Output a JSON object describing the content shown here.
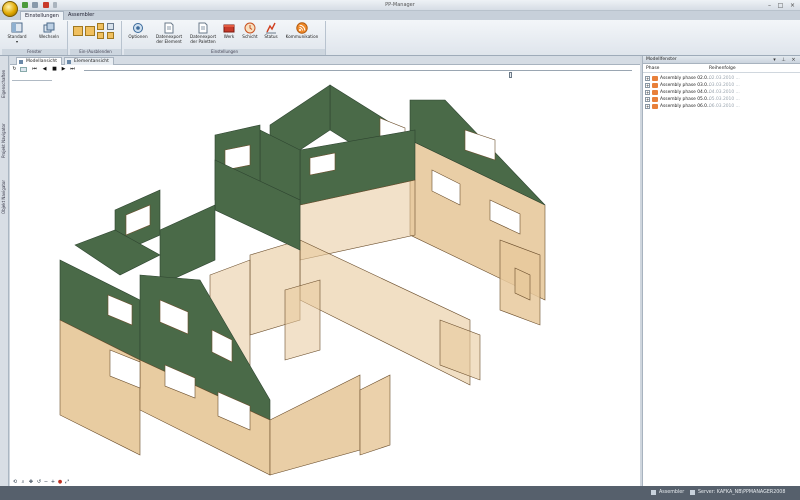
{
  "window": {
    "title": "PP-Manager"
  },
  "ribbon": {
    "tabs": [
      {
        "label": "Einstellungen",
        "active": true
      },
      {
        "label": "Assembler",
        "active": false
      }
    ],
    "groups": [
      {
        "label": "Fenster"
      },
      {
        "label": "Ein-/Ausblenden"
      },
      {
        "label": "Einstellungen"
      }
    ],
    "buttons": {
      "standard": "Standard",
      "wechseln": "Wechseln",
      "optionen": "Optionen",
      "export_element_1": "Datenexport",
      "export_element_2": "der Element",
      "export_paletten_1": "Datenexport",
      "export_paletten_2": "der Paletten",
      "werk": "Werk",
      "schicht": "Schicht",
      "status": "Status",
      "kommunikation": "Kommunikation"
    }
  },
  "left_sidebar": {
    "tabs": [
      "Eigenschaften",
      "Projekt Navigator",
      "Objekt Navigator"
    ]
  },
  "document": {
    "tabs": [
      {
        "label": "Modellansicht",
        "active": true
      },
      {
        "label": "Elementansicht",
        "active": false
      }
    ],
    "timeline_position": 0.78
  },
  "model_panel": {
    "title": "Modellfenster",
    "columns": {
      "phase": "Phase",
      "order": "Reihenfolge"
    },
    "rows": [
      {
        "phase": "Assembly phase 02.0...",
        "date": "02.03.2010 ..."
      },
      {
        "phase": "Assembly phase 03.0...",
        "date": "03.03.2010 ..."
      },
      {
        "phase": "Assembly phase 04.0...",
        "date": "04.03.2010 ..."
      },
      {
        "phase": "Assembly phase 05.0...",
        "date": "05.03.2010 ..."
      },
      {
        "phase": "Assembly phase 06.0...",
        "date": "06.03.2010 ..."
      }
    ]
  },
  "status_bar": {
    "module": "Assembler",
    "server": "Server: KAFKA_NB\\PPMANAGER2008"
  },
  "colors": {
    "roof_green": "#4a6a48",
    "wall_wood": "#e7c99c",
    "wall_edge": "#6b4e2c",
    "accent_orange": "#e8803a"
  }
}
